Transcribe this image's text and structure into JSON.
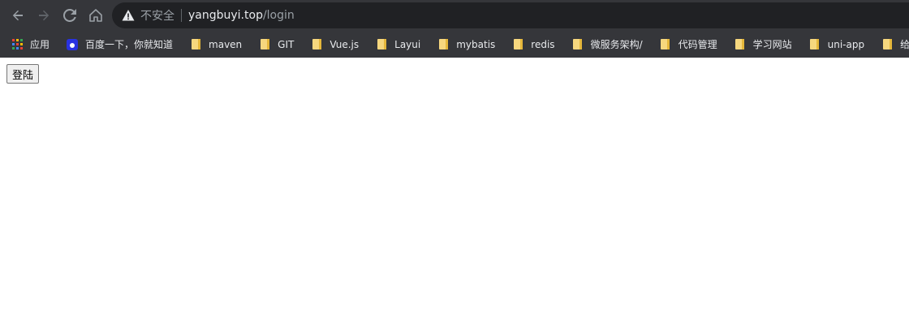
{
  "browser": {
    "security_label": "不安全",
    "url_host": "yangbuyi.top",
    "url_path": "/login",
    "nav_icons": [
      "back-arrow-icon",
      "forward-arrow-icon",
      "reload-icon",
      "home-icon"
    ],
    "bookmarks": [
      {
        "label": "应用",
        "icon": "apps-icon"
      },
      {
        "label": "百度一下，你就知道",
        "icon": "baidu-icon"
      },
      {
        "label": "maven",
        "icon": "folder-icon"
      },
      {
        "label": "GIT",
        "icon": "folder-icon"
      },
      {
        "label": "Vue.js",
        "icon": "folder-icon"
      },
      {
        "label": "Layui",
        "icon": "folder-icon"
      },
      {
        "label": "mybatis",
        "icon": "folder-icon"
      },
      {
        "label": "redis",
        "icon": "folder-icon"
      },
      {
        "label": "微服务架构/",
        "icon": "folder-icon"
      },
      {
        "label": "代码管理",
        "icon": "folder-icon"
      },
      {
        "label": "学习网站",
        "icon": "folder-icon"
      },
      {
        "label": "uni-app",
        "icon": "folder-icon"
      },
      {
        "label": "给表格注入一",
        "icon": "folder-icon"
      }
    ],
    "colors": {
      "toolbar_bg": "#35363a",
      "omnibox_bg": "#202124",
      "folder": "#f6d77e"
    }
  },
  "page": {
    "login_button_label": "登陆"
  }
}
